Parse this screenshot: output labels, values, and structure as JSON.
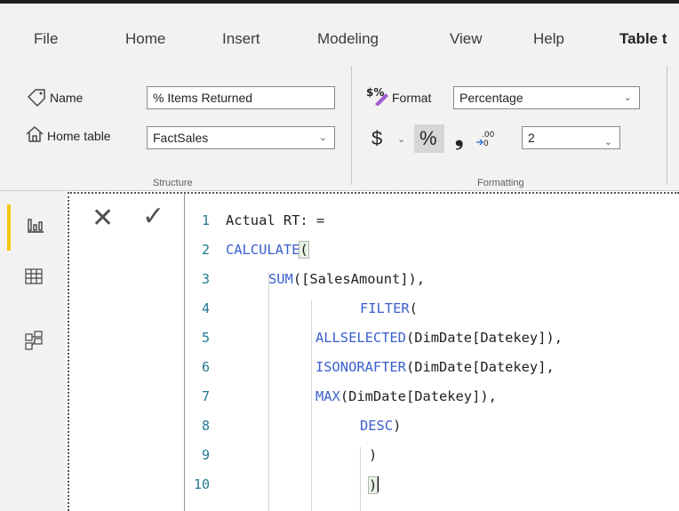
{
  "menu": {
    "items": [
      "File",
      "Home",
      "Insert",
      "Modeling",
      "View",
      "Help",
      "Table t"
    ]
  },
  "structure": {
    "name_label": "Name",
    "name_value": "% Items Returned",
    "home_table_label": "Home table",
    "home_table_value": "FactSales",
    "group_label": "Structure"
  },
  "formatting": {
    "format_label": "Format",
    "format_value": "Percentage",
    "currency_symbol": "$",
    "percent_symbol": "%",
    "comma_symbol": "❟",
    "decimals_value": "2",
    "group_label": "Formatting"
  },
  "formula_bar": {
    "cancel_symbol": "✕",
    "commit_symbol": "✓",
    "line_numbers": [
      "1",
      "2",
      "3",
      "4",
      "5",
      "6",
      "7",
      "8",
      "9",
      "10"
    ],
    "lines": [
      {
        "kw": "",
        "text": "Actual RT: ="
      },
      {
        "kw": "CALCULATE",
        "text": "("
      },
      {
        "kw": "SUM",
        "text": "([SalesAmount]),"
      },
      {
        "kw": "FILTER",
        "text": "("
      },
      {
        "kw": "ALLSELECTED",
        "text": "(DimDate[Datekey]),"
      },
      {
        "kw": "ISONORAFTER",
        "text": "(DimDate[Datekey],"
      },
      {
        "kw": "MAX",
        "text": "(DimDate[Datekey]),"
      },
      {
        "kw": "DESC",
        "text": ")"
      },
      {
        "kw": "",
        "text": ")"
      },
      {
        "kw": "",
        "text": ")"
      }
    ]
  },
  "colors": {
    "accent": "#f2c811",
    "keyword": "#3a5fcd",
    "line_number": "#237893"
  },
  "icons": [
    "tag-icon",
    "home-icon",
    "format-currency-icon",
    "dollar-icon",
    "percent-icon",
    "comma-icon",
    "decimal-icon",
    "report-view-icon",
    "data-view-icon",
    "model-view-icon"
  ]
}
